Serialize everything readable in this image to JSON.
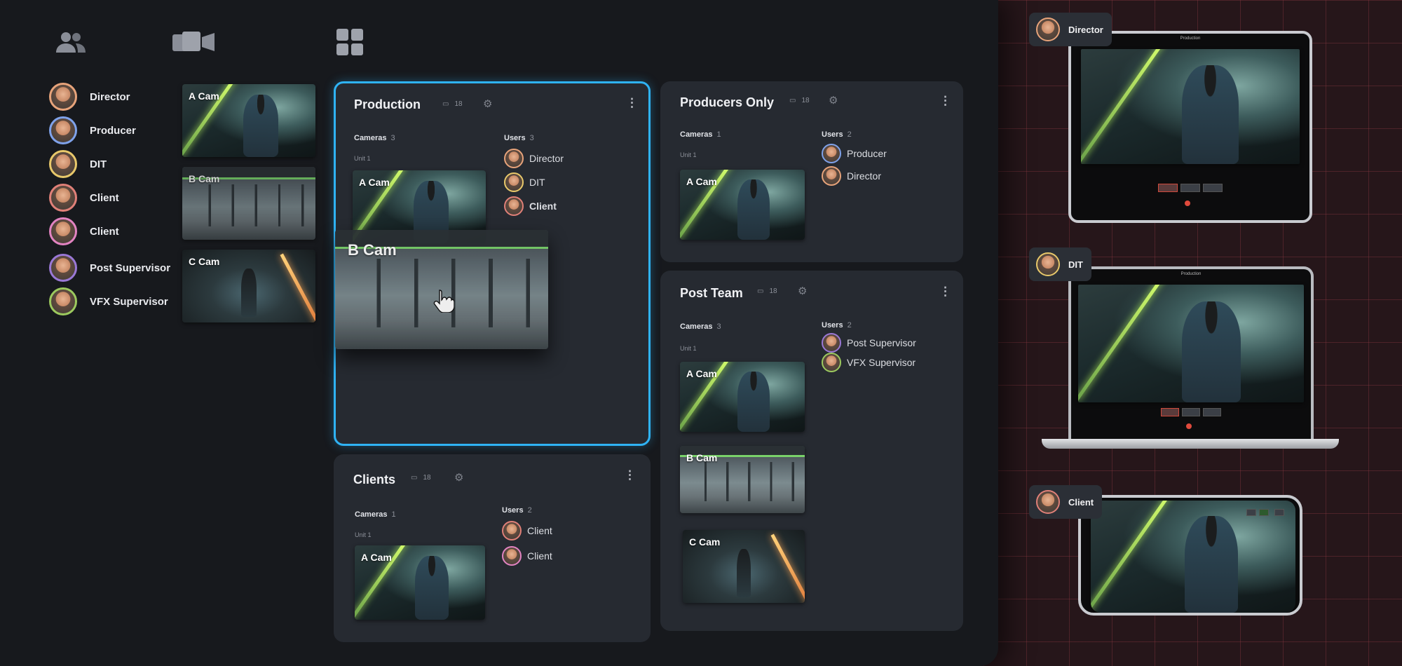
{
  "toolbar": {
    "icons": [
      "users-icon",
      "cameras-icon",
      "grid-icon"
    ]
  },
  "users": [
    {
      "name": "Director",
      "ring": "#e7a37a"
    },
    {
      "name": "Producer",
      "ring": "#7fa2ea"
    },
    {
      "name": "DIT",
      "ring": "#e8c86a"
    },
    {
      "name": "Client",
      "ring": "#e08078"
    },
    {
      "name": "Client",
      "ring": "#e283c1"
    },
    {
      "name": "Post Supervisor",
      "ring": "#9a78d6"
    },
    {
      "name": "VFX Supervisor",
      "ring": "#9cc95e"
    }
  ],
  "cameras": [
    {
      "label": "A Cam"
    },
    {
      "label": "B Cam"
    },
    {
      "label": "C Cam"
    }
  ],
  "dragging": {
    "label": "B Cam"
  },
  "groups": {
    "production": {
      "title": "Production",
      "count": "18",
      "cameras_label": "Cameras",
      "cameras_count": "3",
      "unit": "Unit 1",
      "users_label": "Users",
      "users_count": "3",
      "camera": "A Cam",
      "members": [
        "Director",
        "DIT",
        "Client"
      ]
    },
    "producers": {
      "title": "Producers Only",
      "count": "18",
      "cameras_label": "Cameras",
      "cameras_count": "1",
      "unit": "Unit 1",
      "users_label": "Users",
      "users_count": "2",
      "camera": "A Cam",
      "members": [
        "Producer",
        "Director"
      ]
    },
    "post": {
      "title": "Post Team",
      "count": "18",
      "cameras_label": "Cameras",
      "cameras_count": "3",
      "unit": "Unit 1",
      "users_label": "Users",
      "users_count": "2",
      "cameras_list": [
        "A Cam",
        "B Cam",
        "C Cam"
      ],
      "members": [
        "Post Supervisor",
        "VFX Supervisor"
      ]
    },
    "clients": {
      "title": "Clients",
      "count": "18",
      "cameras_label": "Cameras",
      "cameras_count": "1",
      "unit": "Unit 1",
      "users_label": "Users",
      "users_count": "2",
      "camera": "A Cam",
      "members": [
        "Client",
        "Client"
      ]
    }
  },
  "devices": [
    {
      "user": "Director",
      "type": "tablet",
      "header": "Production"
    },
    {
      "user": "DIT",
      "type": "laptop",
      "header": "Production"
    },
    {
      "user": "Client",
      "type": "phone"
    }
  ]
}
